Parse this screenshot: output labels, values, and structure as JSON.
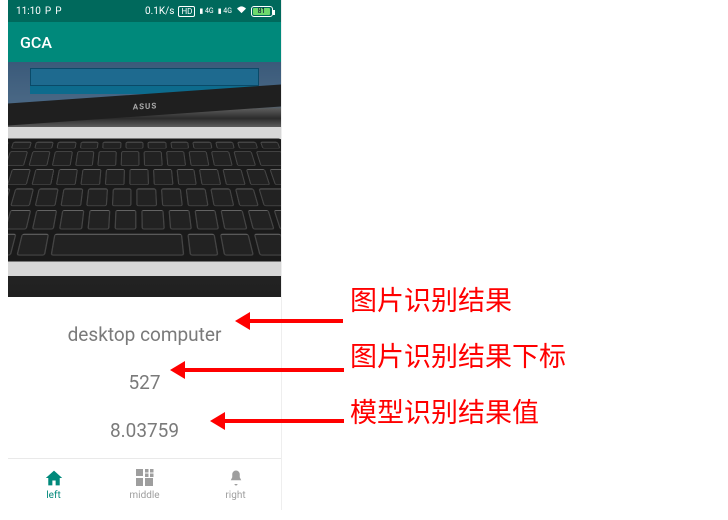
{
  "statusbar": {
    "time": "11:10",
    "net_speed": "0.1K/s",
    "hd": "HD",
    "sig1": "4G",
    "sig2": "4G",
    "battery_pct": "81"
  },
  "appbar": {
    "title": "GCA"
  },
  "photo": {
    "brand": "ASUS"
  },
  "results": {
    "label": "desktop computer",
    "index": "527",
    "value": "8.03759"
  },
  "nav": {
    "left": {
      "label": "left"
    },
    "middle": {
      "label": "middle"
    },
    "right": {
      "label": "right"
    }
  },
  "annotations": {
    "a1": "图片识别结果",
    "a2": "图片识别结果下标",
    "a3": "模型识别结果值"
  }
}
